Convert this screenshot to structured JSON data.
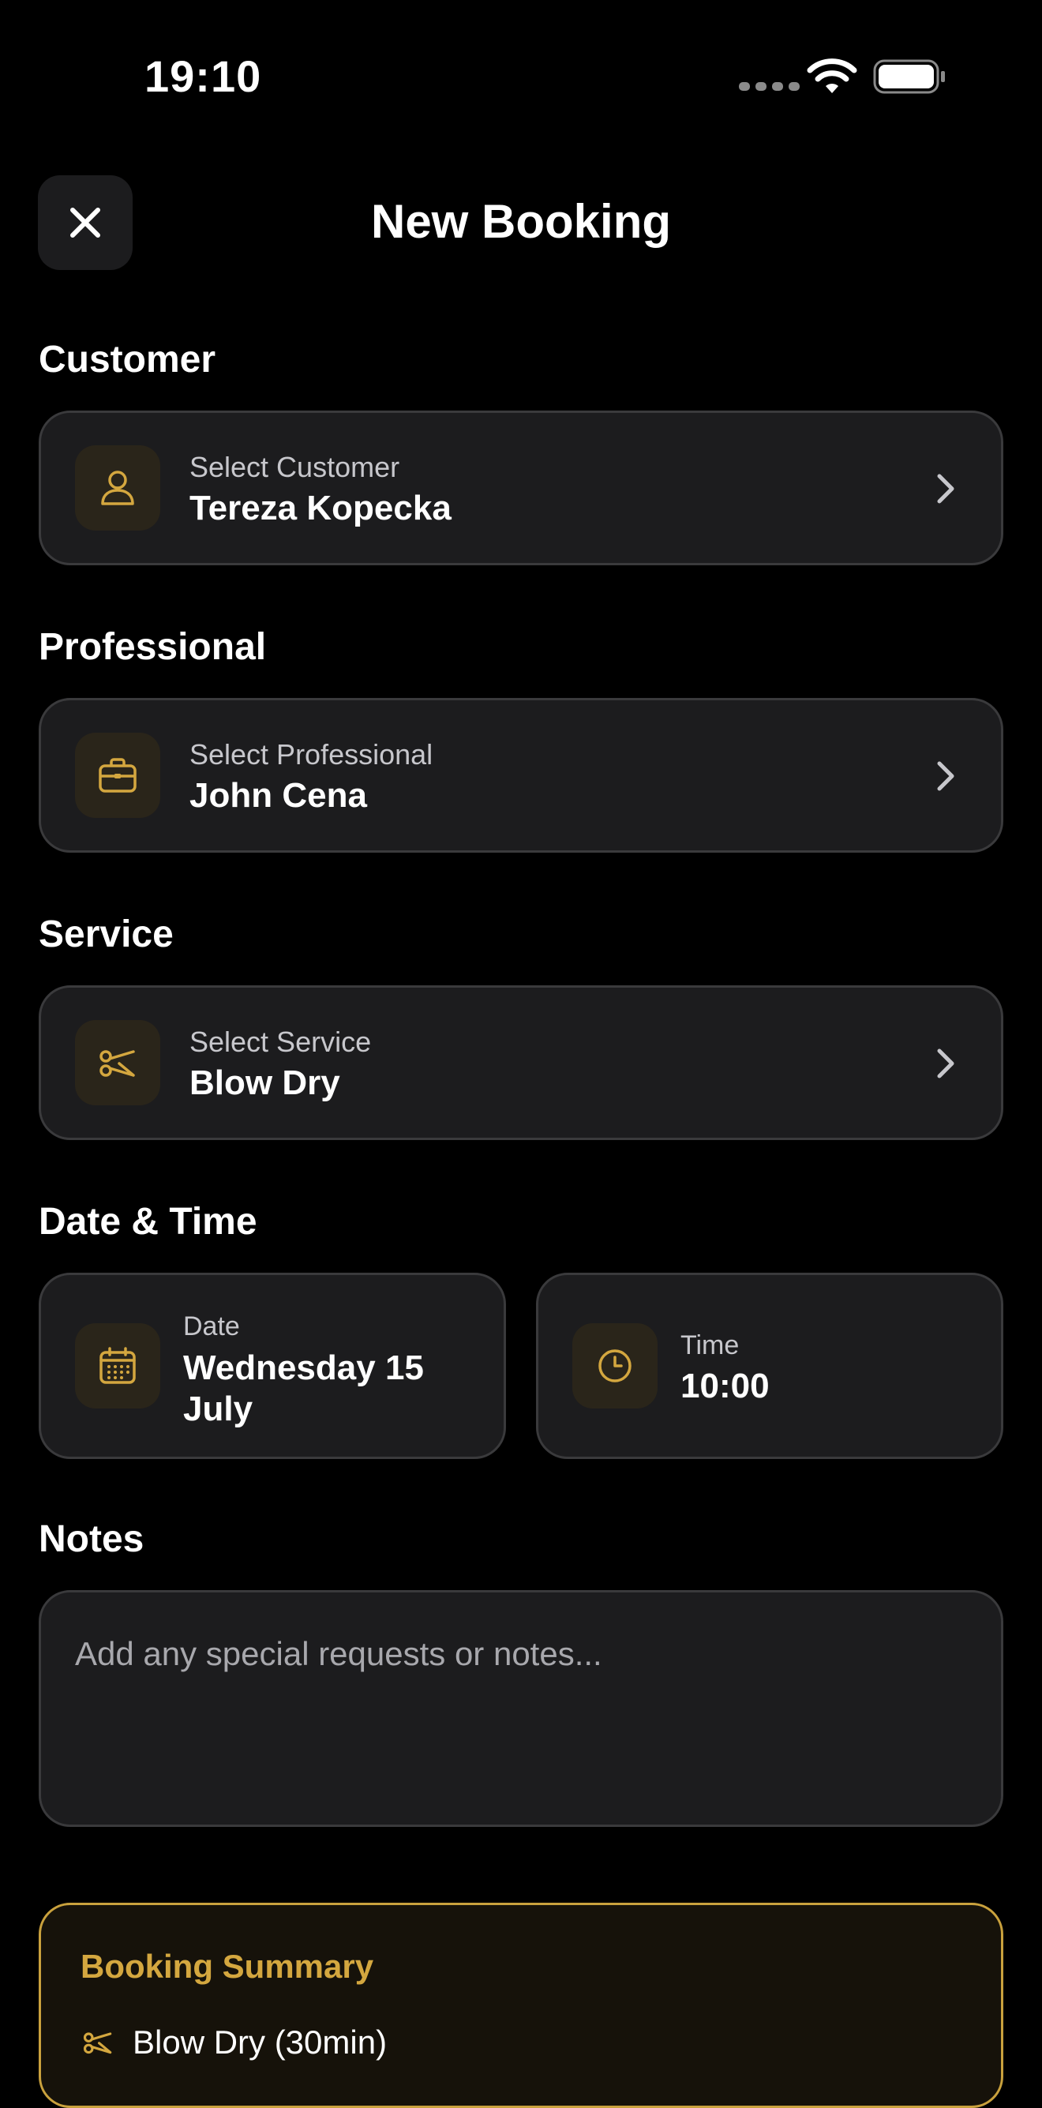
{
  "status_bar": {
    "time": "19:10"
  },
  "header": {
    "title": "New Booking"
  },
  "colors": {
    "accent": "#d4a73f",
    "background": "#000000",
    "card": "#1c1c1e",
    "border": "#3a3a3c"
  },
  "sections": {
    "customer": {
      "title": "Customer",
      "label": "Select Customer",
      "value": "Tereza Kopecka",
      "icon": "person-icon"
    },
    "professional": {
      "title": "Professional",
      "label": "Select Professional",
      "value": "John Cena",
      "icon": "briefcase-icon"
    },
    "service": {
      "title": "Service",
      "label": "Select Service",
      "value": "Blow Dry",
      "icon": "scissors-icon"
    },
    "datetime": {
      "title": "Date & Time",
      "date_label": "Date",
      "date_value": "Wednesday 15 July",
      "time_label": "Time",
      "time_value": "10:00"
    },
    "notes": {
      "title": "Notes",
      "placeholder": "Add any special requests or notes..."
    }
  },
  "summary": {
    "title": "Booking Summary",
    "service_line": "Blow Dry (30min)"
  }
}
